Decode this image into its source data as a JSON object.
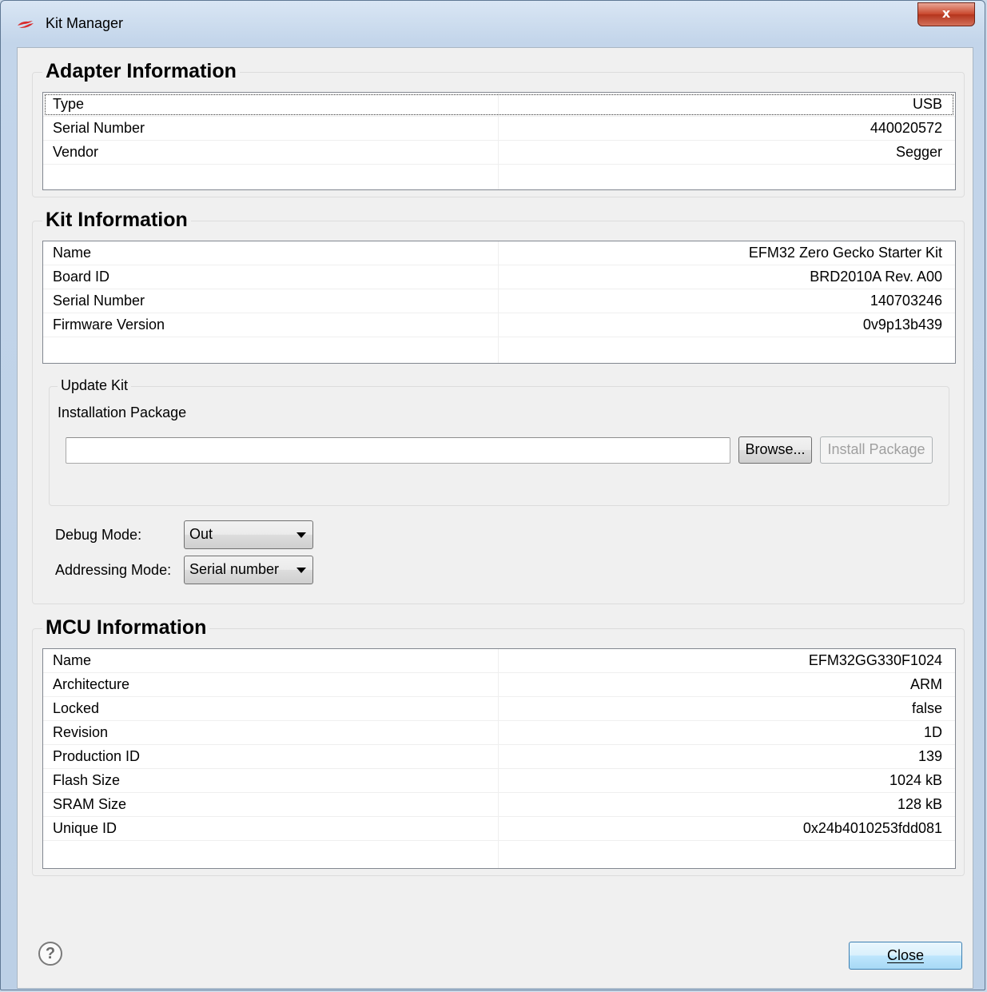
{
  "window": {
    "title": "Kit Manager",
    "close_glyph": "x"
  },
  "adapter": {
    "title": "Adapter Information",
    "rows": [
      {
        "key": "Type",
        "value": "USB"
      },
      {
        "key": "Serial Number",
        "value": "440020572"
      },
      {
        "key": "Vendor",
        "value": "Segger"
      }
    ]
  },
  "kit": {
    "title": "Kit Information",
    "rows": [
      {
        "key": "Name",
        "value": "EFM32 Zero Gecko Starter Kit"
      },
      {
        "key": "Board ID",
        "value": "BRD2010A Rev. A00"
      },
      {
        "key": "Serial Number",
        "value": "140703246"
      },
      {
        "key": "Firmware Version",
        "value": "0v9p13b439"
      }
    ],
    "update": {
      "title": "Update Kit",
      "package_label": "Installation Package",
      "package_value": "",
      "browse_label": "Browse...",
      "install_label": "Install Package"
    },
    "debug_mode_label": "Debug Mode:",
    "debug_mode_value": "Out",
    "addressing_mode_label": "Addressing Mode:",
    "addressing_mode_value": "Serial number"
  },
  "mcu": {
    "title": "MCU Information",
    "rows": [
      {
        "key": "Name",
        "value": "EFM32GG330F1024"
      },
      {
        "key": "Architecture",
        "value": "ARM"
      },
      {
        "key": "Locked",
        "value": "false"
      },
      {
        "key": "Revision",
        "value": "1D"
      },
      {
        "key": "Production ID",
        "value": "139"
      },
      {
        "key": "Flash Size",
        "value": "1024 kB"
      },
      {
        "key": "SRAM Size",
        "value": "128 kB"
      },
      {
        "key": "Unique ID",
        "value": "0x24b4010253fdd081"
      }
    ]
  },
  "footer": {
    "help_glyph": "?",
    "close_label": "Close"
  },
  "colors": {
    "frame": "#c3d5ea",
    "close_button_red": "#c8462b",
    "client_bg": "#f0f0f0"
  }
}
